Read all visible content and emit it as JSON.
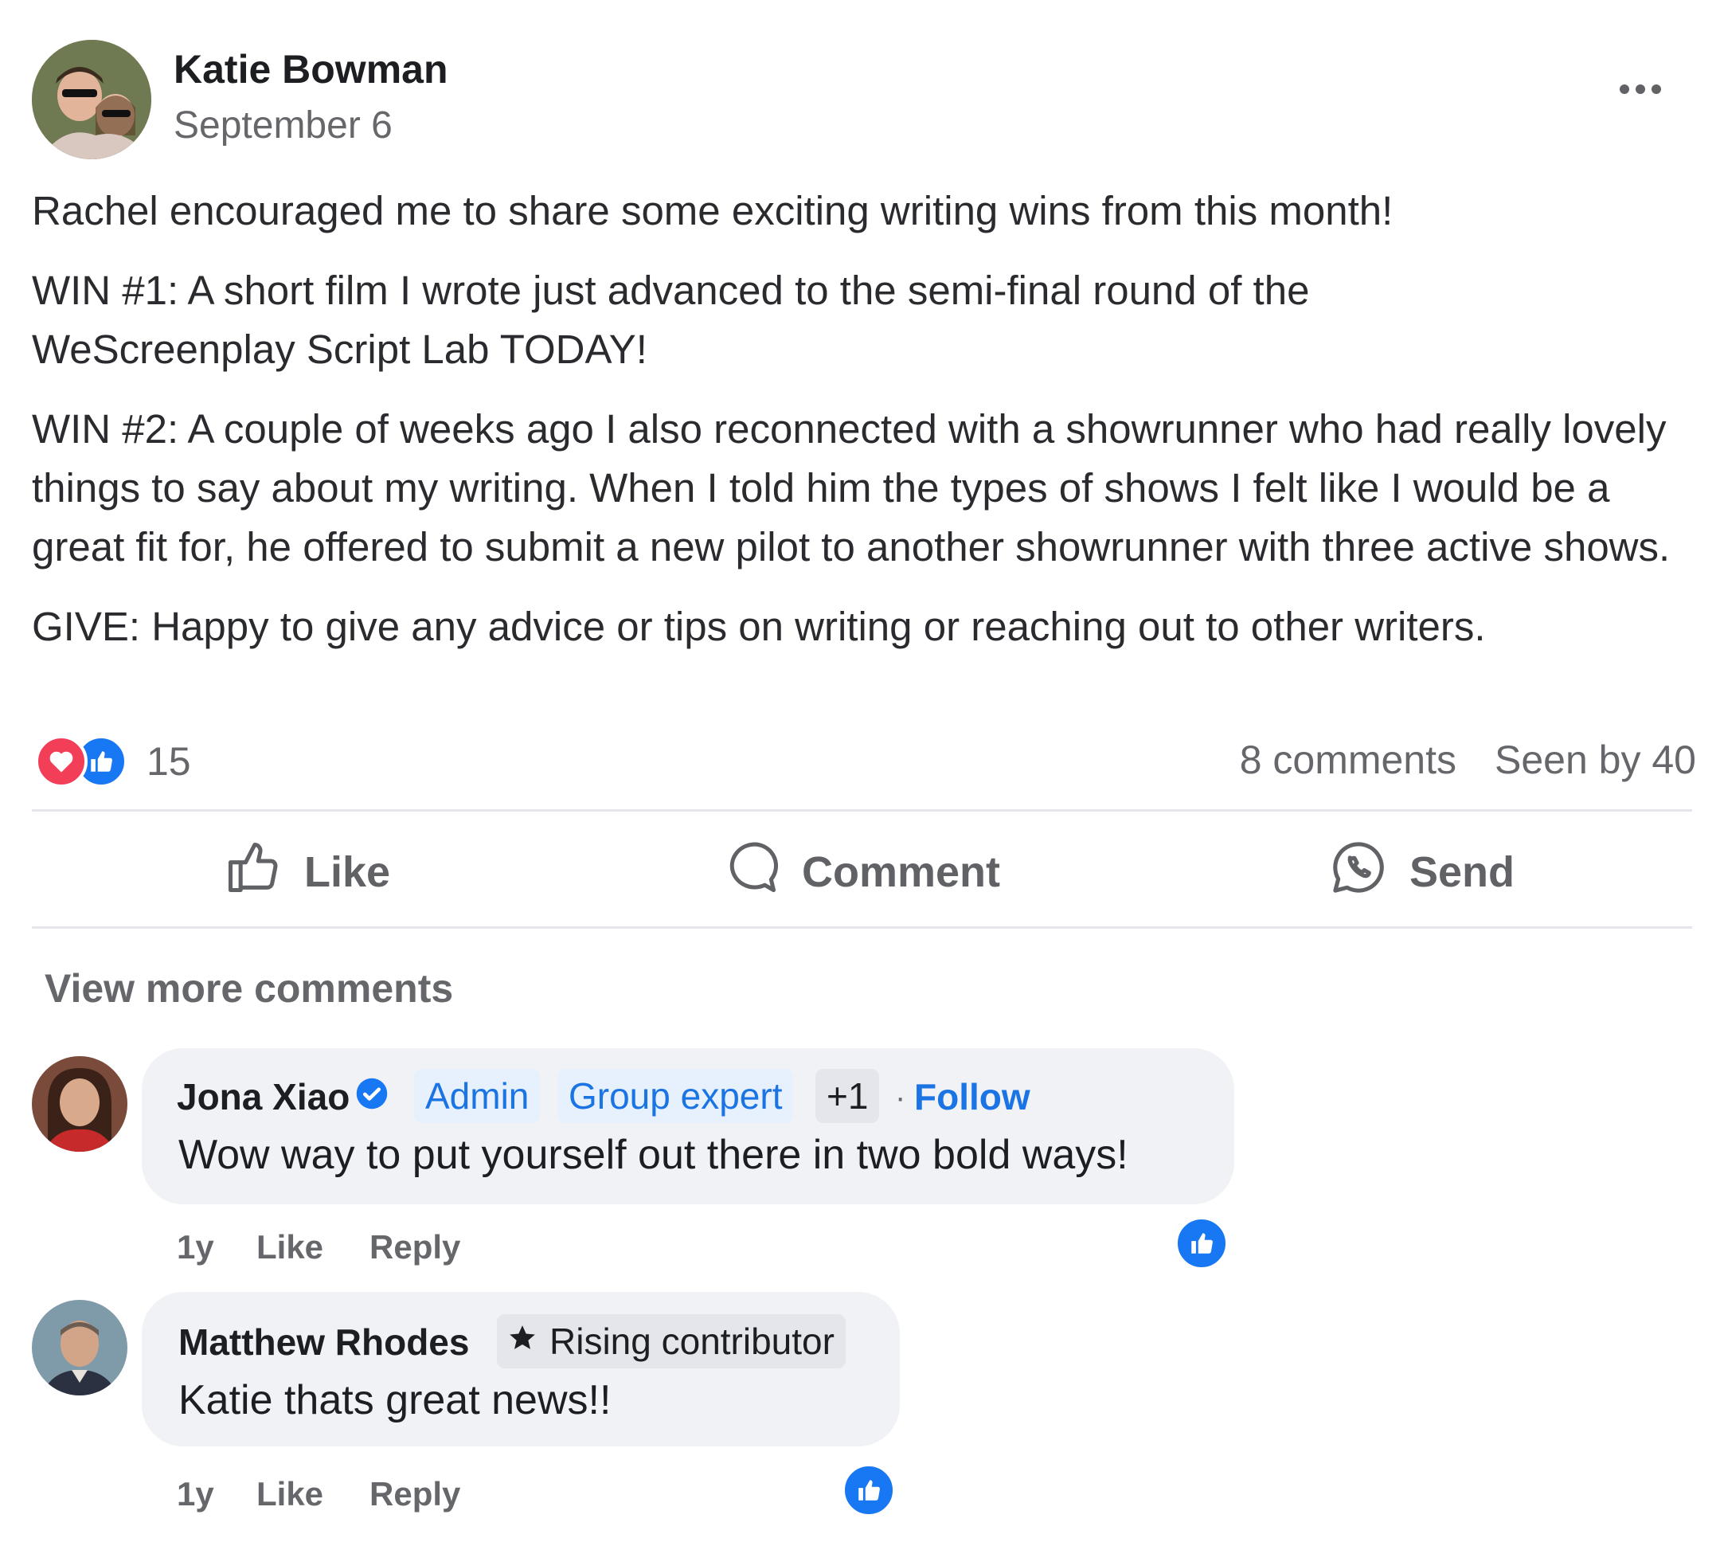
{
  "post": {
    "author": "Katie Bowman",
    "date": "September 6",
    "paragraphs": [
      "Rachel encouraged me to share some exciting writing wins from this month!",
      "WIN #1: A short film I wrote just advanced to the semi-final round of the WeScreenplay Script Lab TODAY!",
      "WIN #2: A couple of weeks ago I also reconnected with a showrunner who had really lovely things to say about my writing. When I told him the types of shows I felt like I would be a great fit for, he offered to submit a new pilot to another showrunner with three active shows.",
      "GIVE: Happy to give any advice or tips on writing or reaching out to other writers."
    ],
    "reaction_count": "15",
    "comments_count": "8 comments",
    "seen_by": "Seen by 40"
  },
  "actions": {
    "like": "Like",
    "comment": "Comment",
    "send": "Send"
  },
  "view_more": "View more comments",
  "comments": [
    {
      "name": "Jona Xiao",
      "badges": [
        "Admin",
        "Group expert",
        "+1"
      ],
      "separator": "·",
      "follow": "Follow",
      "text": "Wow way to put yourself out there in two bold ways!",
      "time": "1y",
      "like": "Like",
      "reply": "Reply"
    },
    {
      "name": "Matthew Rhodes",
      "badges": [
        "Rising contributor"
      ],
      "text": "Katie thats great news!!",
      "time": "1y",
      "like": "Like",
      "reply": "Reply"
    }
  ],
  "colors": {
    "accent": "#1877f2",
    "heart": "#f33e58",
    "bubble": "#f0f2f5",
    "secondary_text": "#65676b"
  },
  "icons": [
    "more-horizontal-icon",
    "heart-reaction-icon",
    "like-reaction-icon",
    "thumbs-up-icon",
    "comment-icon",
    "whatsapp-send-icon",
    "verified-badge-icon",
    "star-icon"
  ]
}
